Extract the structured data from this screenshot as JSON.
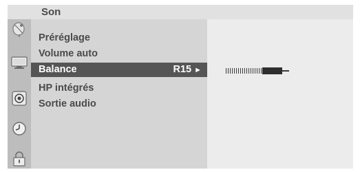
{
  "menu": {
    "title": "Son",
    "items": [
      {
        "label": "Préréglage",
        "selected": false
      },
      {
        "label": "Volume auto",
        "selected": false
      },
      {
        "label": "Balance",
        "selected": true,
        "value": "R15",
        "arrow": "►"
      },
      {
        "label": "HP intégrés",
        "selected": false
      },
      {
        "label": "Sortie audio",
        "selected": false
      }
    ]
  },
  "icons": [
    "satellite-dish-icon",
    "tv-screen-icon",
    "speaker-icon",
    "clock-icon",
    "lock-icon"
  ],
  "balance": {
    "setting": "R15",
    "level_fraction": 0.65
  },
  "colors": {
    "header_bg": "#e1e1e1",
    "icon_column_bg": "#bdbdbd",
    "menu_bg": "#d5d5d5",
    "right_panel_bg": "#ececec",
    "selected_bg": "#555555",
    "text": "#4a4a4a"
  }
}
